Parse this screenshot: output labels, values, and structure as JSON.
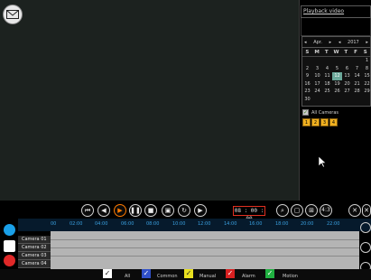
{
  "playback": {
    "title": "Playback video"
  },
  "calendar": {
    "month": "Apr.",
    "year": "2017",
    "weekdays": [
      "S",
      "M",
      "T",
      "W",
      "T",
      "F",
      "S"
    ],
    "days": [
      "",
      "",
      "",
      "",
      "",
      "",
      "1",
      "2",
      "3",
      "4",
      "5",
      "6",
      "7",
      "8",
      "9",
      "10",
      "11",
      "12",
      "13",
      "14",
      "15",
      "16",
      "17",
      "18",
      "19",
      "20",
      "21",
      "22",
      "23",
      "24",
      "25",
      "26",
      "27",
      "28",
      "29",
      "30"
    ],
    "selected_day": "12"
  },
  "cameras": {
    "all_label": "All Cameras",
    "buttons": [
      "1",
      "2",
      "3",
      "4"
    ]
  },
  "controls": {
    "time": "08 : 00 : 00",
    "layout_label": "4:3"
  },
  "timeline": {
    "hours": [
      "00",
      "02:00",
      "04:00",
      "06:00",
      "08:00",
      "10:00",
      "12:00",
      "14:00",
      "16:00",
      "18:00",
      "20:00",
      "22:00"
    ],
    "rows": [
      "Camera 01",
      "Camera 02",
      "Camera 03",
      "Camera 04"
    ]
  },
  "filters": {
    "all": {
      "label": "All",
      "color": "#ffffff"
    },
    "common": {
      "label": "Common",
      "color": "#3050c8"
    },
    "manual": {
      "label": "Manual",
      "color": "#e8e020"
    },
    "alarm": {
      "label": "Alarm",
      "color": "#d82020"
    },
    "motion": {
      "label": "Motion",
      "color": "#20b040"
    }
  },
  "icons": {
    "email": "email-icon",
    "cursor": "mouse-pointer-icon",
    "zoom_in": "zoom-in-icon",
    "zoom_out": "zoom-out-icon"
  }
}
